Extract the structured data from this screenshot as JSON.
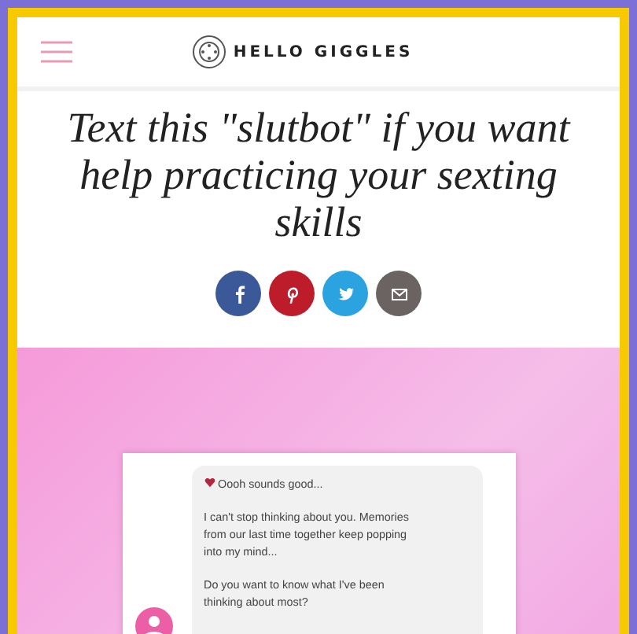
{
  "header": {
    "logo_text": "HELLO GIGGLES"
  },
  "article": {
    "title": "Text this \"slutbot\" if you want help practicing your sexting skills"
  },
  "share_buttons": [
    {
      "kind": "facebook",
      "color": "#3b5998"
    },
    {
      "kind": "pinterest",
      "color": "#bd1c2b"
    },
    {
      "kind": "twitter",
      "color": "#2aa3e0"
    },
    {
      "kind": "email",
      "color": "#6b6362"
    }
  ],
  "chat": {
    "messages": [
      "Oooh sounds good...",
      "I can't stop thinking about you. Memories from our last time together keep popping into my mind...",
      "Do you want to know what I've been thinking about most?"
    ]
  }
}
